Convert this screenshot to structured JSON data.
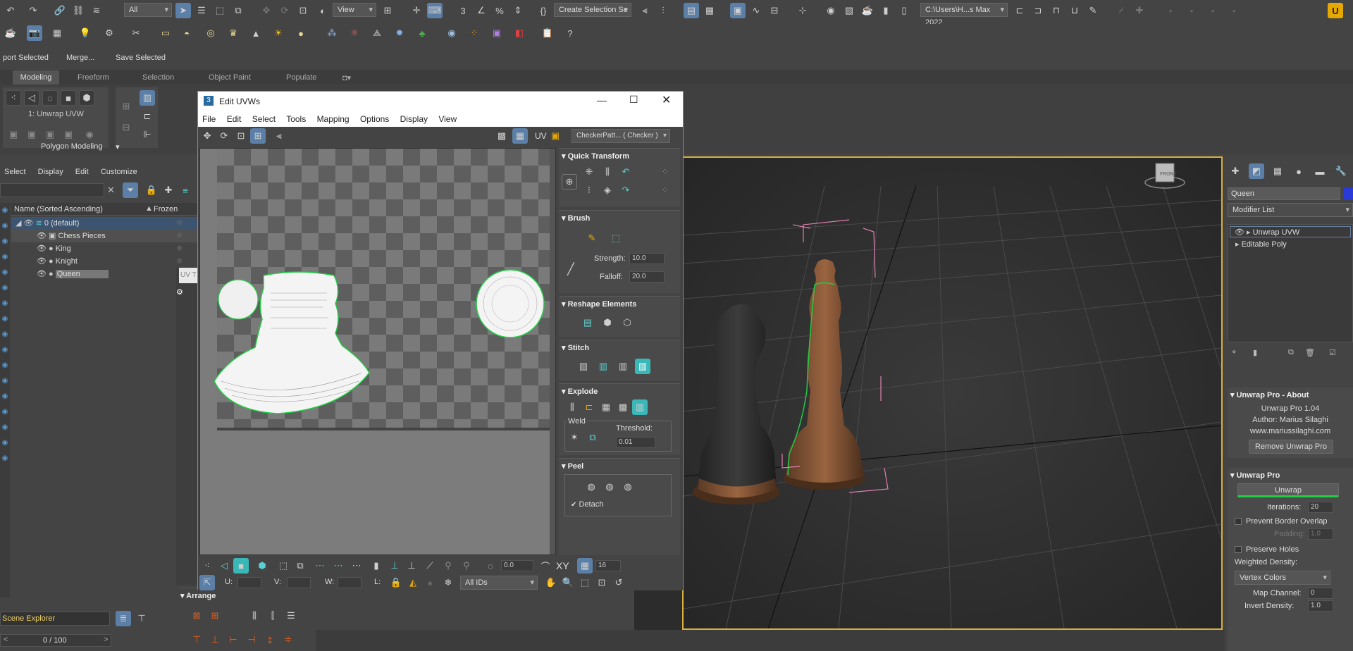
{
  "toolbar1": {
    "filter_dropdown": "All",
    "view_dropdown": "View",
    "selection_set": "Create Selection Se",
    "project_path": "C:\\Users\\H...s Max 2022"
  },
  "toolbar3": {
    "export_selected": "port Selected",
    "merge": "Merge...",
    "save_selected": "Save Selected"
  },
  "ribbon": {
    "tabs": [
      "Modeling",
      "Freeform",
      "Selection",
      "Object Paint",
      "Populate"
    ],
    "modifier_label": "1: Unwrap UVW",
    "group_label": "Polygon Modeling"
  },
  "scene_explorer": {
    "menu": [
      "Select",
      "Display",
      "Edit",
      "Customize"
    ],
    "col_name": "Name (Sorted Ascending)",
    "col_frozen": "Frozen",
    "rows": [
      "0 (default)",
      "Chess Pieces",
      "King",
      "Knight",
      "Queen"
    ],
    "footer_label": "Scene Explorer",
    "frame_counter": "0 / 100"
  },
  "edit_uvws": {
    "title": "Edit UVWs",
    "menu": [
      "File",
      "Edit",
      "Select",
      "Tools",
      "Mapping",
      "Options",
      "Display",
      "View"
    ],
    "uv_label": "UV",
    "texture_dropdown": "CheckerPatt... ( Checker )",
    "quick_transform": "Quick Transform",
    "brush": "Brush",
    "strength_label": "Strength:",
    "strength_value": "10.0",
    "falloff_label": "Falloff:",
    "falloff_value": "20.0",
    "reshape": "Reshape Elements",
    "stitch": "Stitch",
    "explode": "Explode",
    "weld": "Weld",
    "threshold_label": "Threshold:",
    "threshold_value": "0.01",
    "peel": "Peel",
    "detach": "Detach",
    "bottom_spin1": "0.0",
    "xy_label": "XY",
    "bottom_spin2": "16",
    "u_label": "U:",
    "v_label": "V:",
    "w_label": "W:",
    "l_label": "L:",
    "ids_dropdown": "All IDs"
  },
  "arrange": {
    "title": "Arrange"
  },
  "command_panel": {
    "object_name": "Queen",
    "modifier_list": "Modifier List",
    "stack": [
      "Unwrap UVW",
      "Editable Poly"
    ],
    "about_header": "Unwrap Pro - About",
    "version": "Unwrap Pro 1.04",
    "author": "Author: Marius Silaghi",
    "website": "www.mariussilaghi.com",
    "remove_btn": "Remove Unwrap Pro",
    "unwrap_header": "Unwrap Pro",
    "unwrap_btn": "Unwrap",
    "iterations_label": "Iterations:",
    "iterations_value": "20",
    "prevent_overlap": "Prevent Border Overlap",
    "padding_label": "Padding:",
    "padding_value": "1.0",
    "preserve_holes": "Preserve Holes",
    "weighted_density": "Weighted Density:",
    "vertex_colors": "Vertex Colors",
    "map_channel_label": "Map Channel:",
    "map_channel_value": "0",
    "invert_density": "Invert Density:",
    "invert_value": "1.0"
  },
  "colors": {
    "accent_blue": "#5b7fa7",
    "uv_green": "#22cc44",
    "teal": "#3ab8b8"
  }
}
